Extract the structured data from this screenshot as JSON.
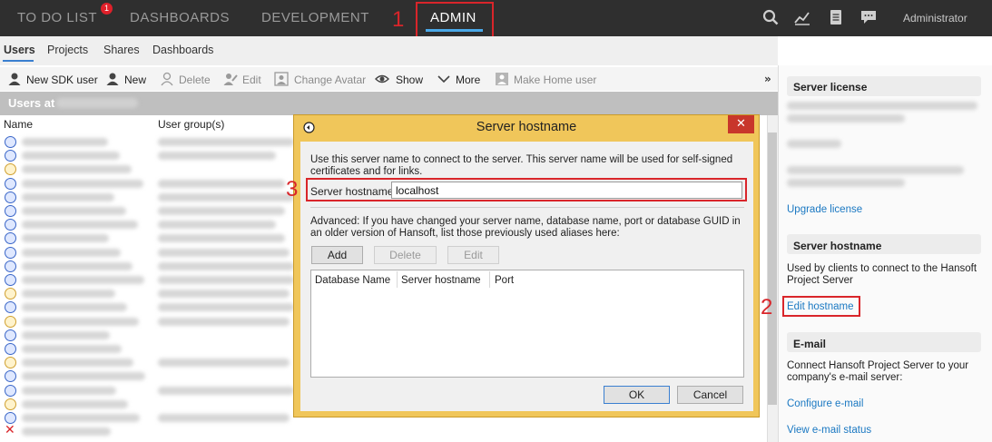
{
  "nav": {
    "items": [
      {
        "label": "TO DO LIST",
        "badge": "1"
      },
      {
        "label": "DASHBOARDS"
      },
      {
        "label": "DEVELOPMENT"
      },
      {
        "label": "ADMIN"
      }
    ],
    "user": "Administrator",
    "icons": [
      "search-icon",
      "chart-icon",
      "document-icon",
      "chat-icon"
    ]
  },
  "annotations": [
    "1",
    "2",
    "3"
  ],
  "subtabs": [
    "Users",
    "Projects",
    "Shares",
    "Dashboards"
  ],
  "toolbar": {
    "new_sdk_user": "New SDK user",
    "new": "New",
    "delete": "Delete",
    "edit": "Edit",
    "change_avatar": "Change Avatar",
    "show": "Show",
    "more": "More",
    "make_home_user": "Make Home user",
    "overflow": "»"
  },
  "users": {
    "header": "Users at",
    "columns": [
      "Name",
      "User group(s)"
    ]
  },
  "right_panel": {
    "license": {
      "title": "Server license",
      "link": "Upgrade license"
    },
    "hostname": {
      "title": "Server hostname",
      "text": "Used by clients to connect to the Hansoft Project Server",
      "link": "Edit hostname"
    },
    "email": {
      "title": "E-mail",
      "text": "Connect Hansoft Project Server to your company's e-mail server:",
      "link1": "Configure e-mail",
      "link2": "View e-mail status"
    }
  },
  "dialog": {
    "title": "Server hostname",
    "close": "✕",
    "intro": "Use this server name to connect to the server. This server name will be used for self-signed certificates and for links.",
    "field_label": "Server hostname",
    "field_value": "localhost",
    "advanced": "Advanced: If you have changed your server name, database name, port or database GUID in an older version of Hansoft, list those previously used aliases here:",
    "buttons": {
      "add": "Add",
      "delete": "Delete",
      "edit": "Edit",
      "ok": "OK",
      "cancel": "Cancel"
    },
    "grid_columns": [
      "Database Name",
      "Server hostname",
      "Port"
    ]
  }
}
